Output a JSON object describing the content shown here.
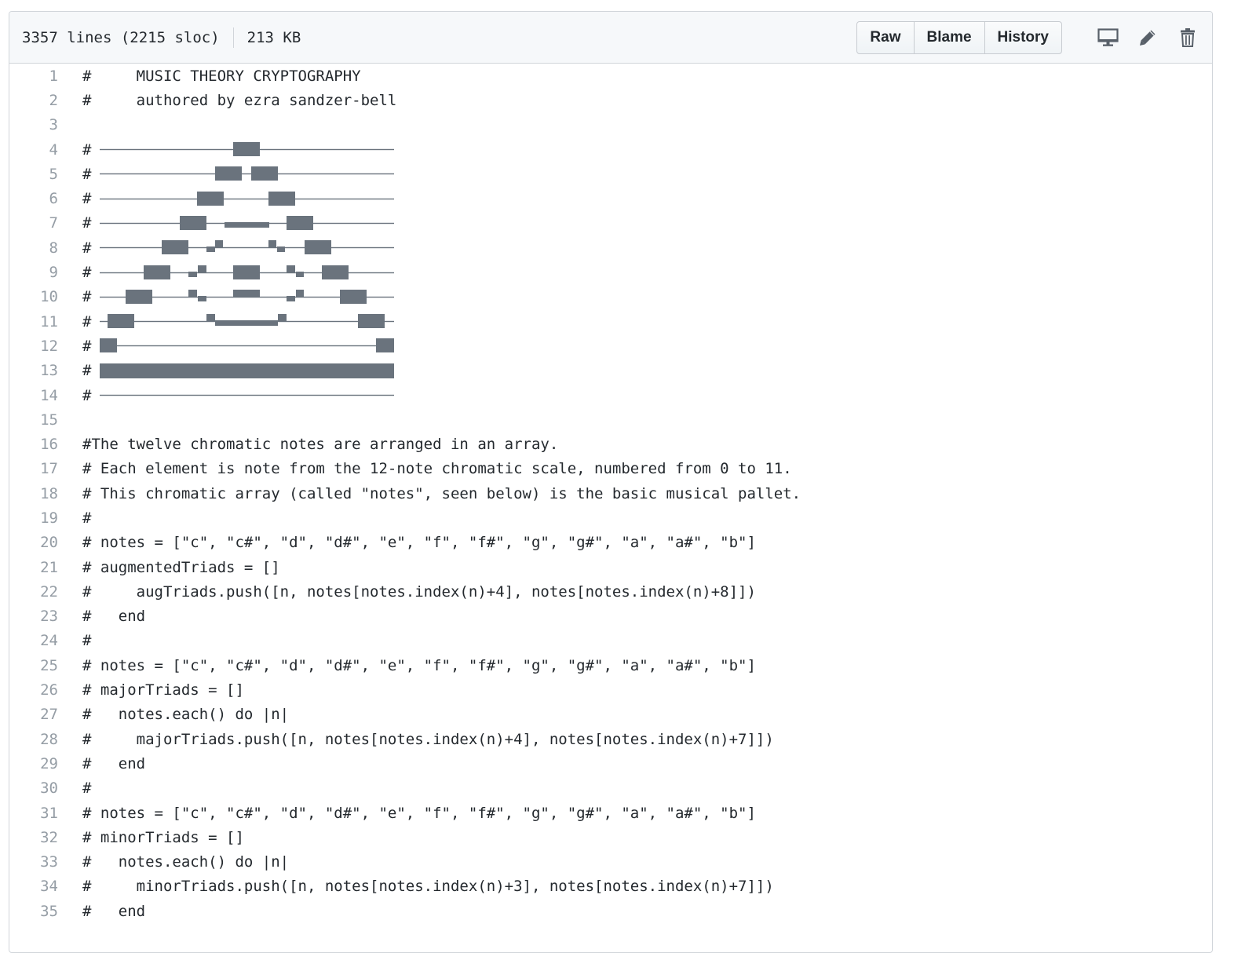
{
  "file": {
    "lines_info": "3357 lines (2215 sloc)",
    "size": "213 KB"
  },
  "actions": {
    "raw": "Raw",
    "blame": "Blame",
    "history": "History"
  },
  "icons": {
    "display": "desktop-icon",
    "edit": "pencil-icon",
    "delete": "trash-icon"
  },
  "colors": {
    "art": "#6a737d",
    "line_number": "#959da5",
    "text": "#24292e",
    "border": "#d1d5da",
    "header_bg": "#f6f8fa"
  },
  "code_lines": [
    {
      "n": "1",
      "text": "#     MUSIC THEORY CRYPTOGRAPHY"
    },
    {
      "n": "2",
      "text": "#     authored by ezra sandzer-bell"
    },
    {
      "n": "3",
      "text": ""
    },
    {
      "n": "4",
      "text": "#",
      "art": 0
    },
    {
      "n": "5",
      "text": "#",
      "art": 1
    },
    {
      "n": "6",
      "text": "#",
      "art": 2
    },
    {
      "n": "7",
      "text": "#",
      "art": 3
    },
    {
      "n": "8",
      "text": "#",
      "art": 4
    },
    {
      "n": "9",
      "text": "#",
      "art": 5
    },
    {
      "n": "10",
      "text": "#",
      "art": 6
    },
    {
      "n": "11",
      "text": "#",
      "art": 7
    },
    {
      "n": "12",
      "text": "#",
      "art": 8
    },
    {
      "n": "13",
      "text": "#",
      "art": 9
    },
    {
      "n": "14",
      "text": "#",
      "art": 10
    },
    {
      "n": "15",
      "text": ""
    },
    {
      "n": "16",
      "text": "#The twelve chromatic notes are arranged in an array."
    },
    {
      "n": "17",
      "text": "# Each element is note from the 12-note chromatic scale, numbered from 0 to 11."
    },
    {
      "n": "18",
      "text": "# This chromatic array (called \"notes\", seen below) is the basic musical pallet."
    },
    {
      "n": "19",
      "text": "#"
    },
    {
      "n": "20",
      "text": "# notes = [\"c\", \"c#\", \"d\", \"d#\", \"e\", \"f\", \"f#\", \"g\", \"g#\", \"a\", \"a#\", \"b\"]"
    },
    {
      "n": "21",
      "text": "# augmentedTriads = []"
    },
    {
      "n": "22",
      "text": "#     augTriads.push([n, notes[notes.index(n)+4], notes[notes.index(n)+8]])"
    },
    {
      "n": "23",
      "text": "#   end"
    },
    {
      "n": "24",
      "text": "#"
    },
    {
      "n": "25",
      "text": "# notes = [\"c\", \"c#\", \"d\", \"d#\", \"e\", \"f\", \"f#\", \"g\", \"g#\", \"a\", \"a#\", \"b\"]"
    },
    {
      "n": "26",
      "text": "# majorTriads = []"
    },
    {
      "n": "27",
      "text": "#   notes.each() do |n|"
    },
    {
      "n": "28",
      "text": "#     majorTriads.push([n, notes[notes.index(n)+4], notes[notes.index(n)+7]])"
    },
    {
      "n": "29",
      "text": "#   end"
    },
    {
      "n": "30",
      "text": "#"
    },
    {
      "n": "31",
      "text": "# notes = [\"c\", \"c#\", \"d\", \"d#\", \"e\", \"f\", \"f#\", \"g\", \"g#\", \"a\", \"a#\", \"b\"]"
    },
    {
      "n": "32",
      "text": "# minorTriads = []"
    },
    {
      "n": "33",
      "text": "#   notes.each() do |n|"
    },
    {
      "n": "34",
      "text": "#     minorTriads.push([n, notes[notes.index(n)+3], notes[notes.index(n)+7]])"
    },
    {
      "n": "35",
      "text": "#   end"
    }
  ]
}
